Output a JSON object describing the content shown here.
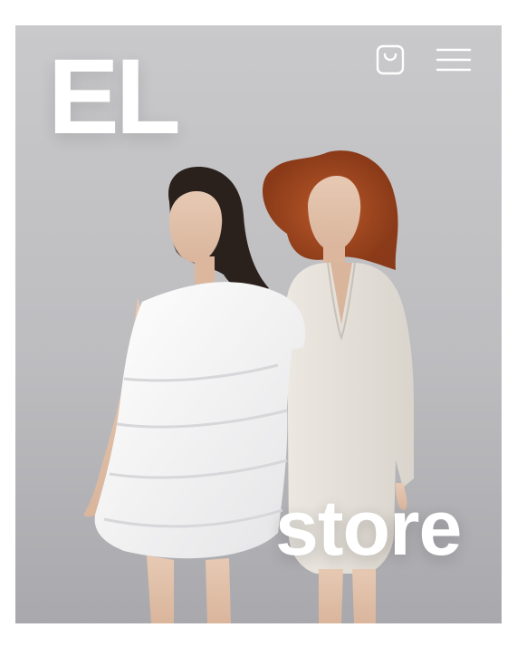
{
  "header": {
    "logo_text": "EL",
    "cart_icon": "shopping-bag-icon",
    "menu_icon": "hamburger-menu-icon"
  },
  "hero": {
    "overlay_word": "store",
    "image": "two-models-white-dresses",
    "text_color": "#ffffff"
  }
}
